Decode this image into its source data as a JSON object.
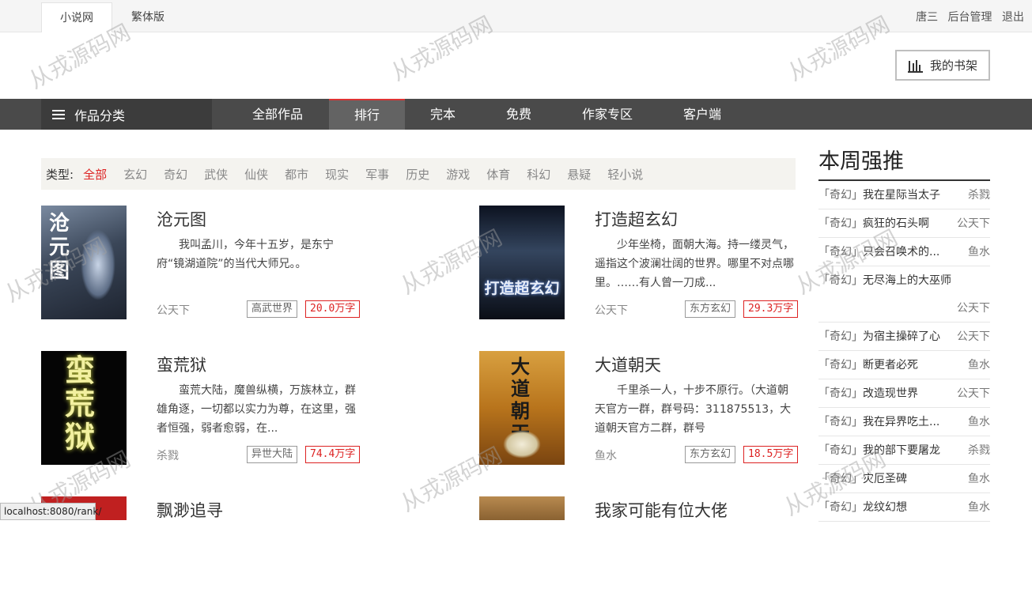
{
  "topbar": {
    "tabs": [
      "小说网",
      "繁体版"
    ],
    "user": "唐三",
    "admin": "后台管理",
    "logout": "退出"
  },
  "shelf": {
    "label": "我的书架",
    "icon": "bookshelf-chart-icon"
  },
  "nav": {
    "category": "作品分类",
    "items": [
      "全部作品",
      "排行",
      "完本",
      "免费",
      "作家专区",
      "客户端"
    ],
    "active_index": 1
  },
  "filter": {
    "label": "类型:",
    "options": [
      "全部",
      "玄幻",
      "奇幻",
      "武侠",
      "仙侠",
      "都市",
      "现实",
      "军事",
      "历史",
      "游戏",
      "体育",
      "科幻",
      "悬疑",
      "轻小说"
    ],
    "selected": "全部"
  },
  "books": [
    {
      "title": "沧元图",
      "desc": "我叫孟川，今年十五岁，是东宁府“镜湖道院”的当代大师兄。。",
      "author": "公天下",
      "genre": "高武世界",
      "words": "20.0万字",
      "cover_text": "沧元图"
    },
    {
      "title": "打造超玄幻",
      "desc": "少年坐椅，面朝大海。持一缕灵气，遥指这个波澜壮阔的世界。哪里不对点哪里。……有人曾一刀成...",
      "author": "公天下",
      "genre": "东方玄幻",
      "words": "29.3万字",
      "cover_text": "打造超玄幻"
    },
    {
      "title": "蛮荒狱",
      "desc": "蛮荒大陆，魔兽纵横，万族林立，群雄角逐，一切都以实力为尊，在这里，强者恒强，弱者愈弱，在...",
      "author": "杀戮",
      "genre": "异世大陆",
      "words": "74.4万字",
      "cover_text": "蛮荒狱"
    },
    {
      "title": "大道朝天",
      "desc": "千里杀一人，十步不原行。（大道朝天官方一群，群号码：311875513，大道朝天官方二群，群号",
      "author": "鱼水",
      "genre": "东方玄幻",
      "words": "18.5万字",
      "cover_text": "大道朝天"
    },
    {
      "title": "飘渺追寻"
    },
    {
      "title": "我家可能有位大佬"
    }
  ],
  "sidebar": {
    "title": "本周强推",
    "items": [
      {
        "tag": "「奇幻」",
        "name": "我在星际当太子",
        "author": "杀戮"
      },
      {
        "tag": "「奇幻」",
        "name": "疯狂的石头啊",
        "author": "公天下"
      },
      {
        "tag": "「奇幻」",
        "name": "只会召唤术的...",
        "author": "鱼水"
      },
      {
        "tag": "「奇幻」",
        "name": "无尽海上的大巫师",
        "author": "公天下"
      },
      {
        "tag": "「奇幻」",
        "name": "为宿主操碎了心",
        "author": "公天下"
      },
      {
        "tag": "「奇幻」",
        "name": "断更者必死",
        "author": "鱼水"
      },
      {
        "tag": "「奇幻」",
        "name": "改造现世界",
        "author": "公天下"
      },
      {
        "tag": "「奇幻」",
        "name": "我在异界吃土...",
        "author": "鱼水"
      },
      {
        "tag": "「奇幻」",
        "name": "我的部下要屠龙",
        "author": "杀戮"
      },
      {
        "tag": "「奇幻」",
        "name": "灾厄圣碑",
        "author": "鱼水"
      },
      {
        "tag": "「奇幻」",
        "name": "龙纹幻想",
        "author": "鱼水"
      }
    ]
  },
  "statusbar": {
    "url": "localhost:8080/rank/"
  },
  "watermark": "从戎源码网",
  "colors": {
    "accent": "#dd2222",
    "nav": "#4a4a4a"
  }
}
